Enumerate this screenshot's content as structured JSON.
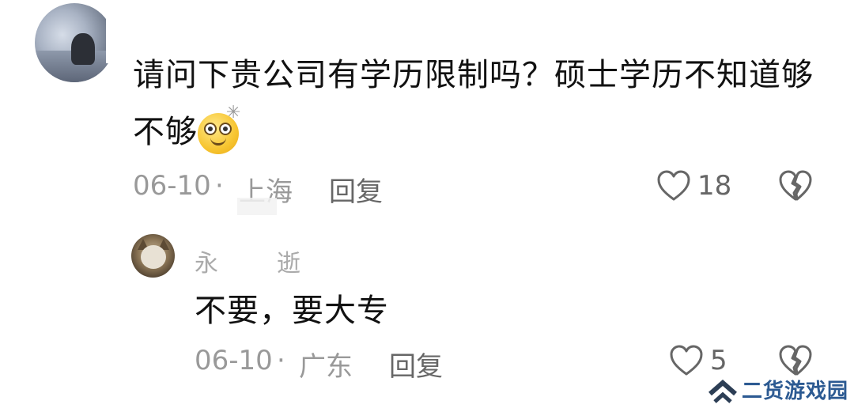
{
  "comment": {
    "text_line1": "请问下贵公司有学历限制吗？硕士学历不知道够",
    "text_line2": "不够",
    "emoji_icon": "glasses-smile-emoji",
    "date": "06-10",
    "separator": "·",
    "location": "上海",
    "reply_label": "回复",
    "like_count": "18"
  },
  "reply": {
    "username_first": "永",
    "username_last": "逝",
    "text": "不要，要大专",
    "date": "06-10",
    "separator": "·",
    "location": "广东",
    "reply_label": "回复",
    "like_count": "5"
  },
  "watermark": {
    "text": "二货游戏园",
    "color": "#2c5a92"
  },
  "colors": {
    "text": "#111111",
    "meta": "#999999",
    "icon": "#666666"
  }
}
